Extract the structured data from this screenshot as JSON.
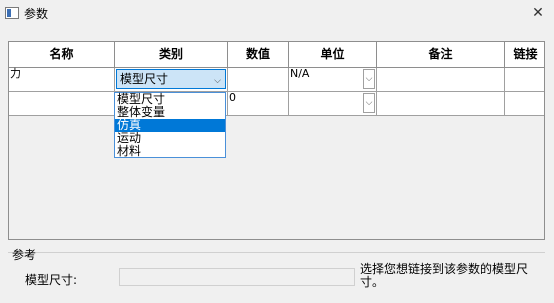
{
  "window": {
    "title": "参数",
    "close_glyph": "✕"
  },
  "grid": {
    "columns": [
      "名称",
      "类别",
      "数值",
      "单位",
      "备注",
      "链接"
    ],
    "rows": [
      {
        "name": "力",
        "category": "模型尺寸",
        "value": "",
        "unit": "N/A",
        "note": "",
        "link": ""
      },
      {
        "name": "",
        "category": "",
        "value": "0",
        "unit": "",
        "note": "",
        "link": ""
      }
    ],
    "combo_arrow": "⌵"
  },
  "category_dropdown": {
    "options": [
      "模型尺寸",
      "整体变量",
      "仿真",
      "运动",
      "材料"
    ],
    "highlighted": "仿真"
  },
  "reference": {
    "group_title": "参考",
    "field_label": "模型尺寸:",
    "field_value": "",
    "description": "选择您想链接到该参数的模型尺寸。"
  },
  "colors": {
    "accent": "#0078d7",
    "active_cell": "#cce4f7"
  }
}
